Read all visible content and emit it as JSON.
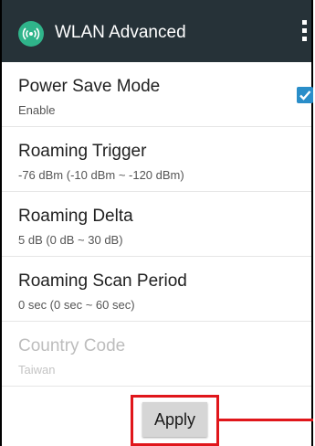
{
  "app_bar": {
    "title": "WLAN Advanced",
    "app_icon": "wifi-signal-icon",
    "menu_icon": "overflow-menu-icon",
    "background_color": "#263238",
    "icon_color": "#2fb48a"
  },
  "preferences": [
    {
      "title": "Power Save Mode",
      "summary": "Enable",
      "checked": true,
      "enabled": true
    },
    {
      "title": "Roaming Trigger",
      "summary": "-76 dBm  (-10 dBm ~ -120 dBm)",
      "enabled": true
    },
    {
      "title": "Roaming Delta",
      "summary": "5 dB  (0 dB ~ 30 dB)",
      "enabled": true
    },
    {
      "title": "Roaming Scan Period",
      "summary": "0 sec (0 sec ~ 60 sec)",
      "enabled": true
    },
    {
      "title": "Country Code",
      "summary": "Taiwan",
      "enabled": false
    }
  ],
  "apply_button": {
    "label": "Apply"
  },
  "colors": {
    "checkbox": "#2a8ec9",
    "annotation": "#e0161b"
  }
}
